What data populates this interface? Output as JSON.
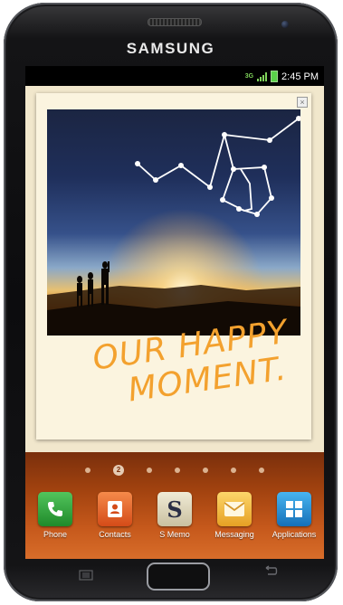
{
  "device": {
    "brand": "SAMSUNG"
  },
  "statusbar": {
    "network": "3G",
    "time": "2:45 PM",
    "icons": [
      "network-3g-icon",
      "signal-icon",
      "battery-icon"
    ],
    "colors": {
      "signal": "#7fd35a",
      "battery": "#5ad14a"
    }
  },
  "wallpaper": {
    "handwriting_line1": "OUR HAPPY",
    "handwriting_line2": "MOMENT.",
    "handwriting_color": "#f3a12e",
    "widget_close": "×"
  },
  "home": {
    "pages": 7,
    "current_page": 2,
    "current_page_label": "2"
  },
  "dock": {
    "apps": [
      {
        "label": "Phone",
        "icon": "phone-icon",
        "color": "#2fa33a"
      },
      {
        "label": "Contacts",
        "icon": "contacts-icon",
        "color": "#e6622a"
      },
      {
        "label": "S Memo",
        "icon": "s-memo-icon",
        "color": "#d9d2b0"
      },
      {
        "label": "Messaging",
        "icon": "messaging-icon",
        "color": "#f0b838"
      },
      {
        "label": "Applications",
        "icon": "applications-grid-icon",
        "color": "#1f8fd6"
      }
    ]
  },
  "hardware_keys": [
    "menu-key",
    "home-key",
    "back-key"
  ]
}
